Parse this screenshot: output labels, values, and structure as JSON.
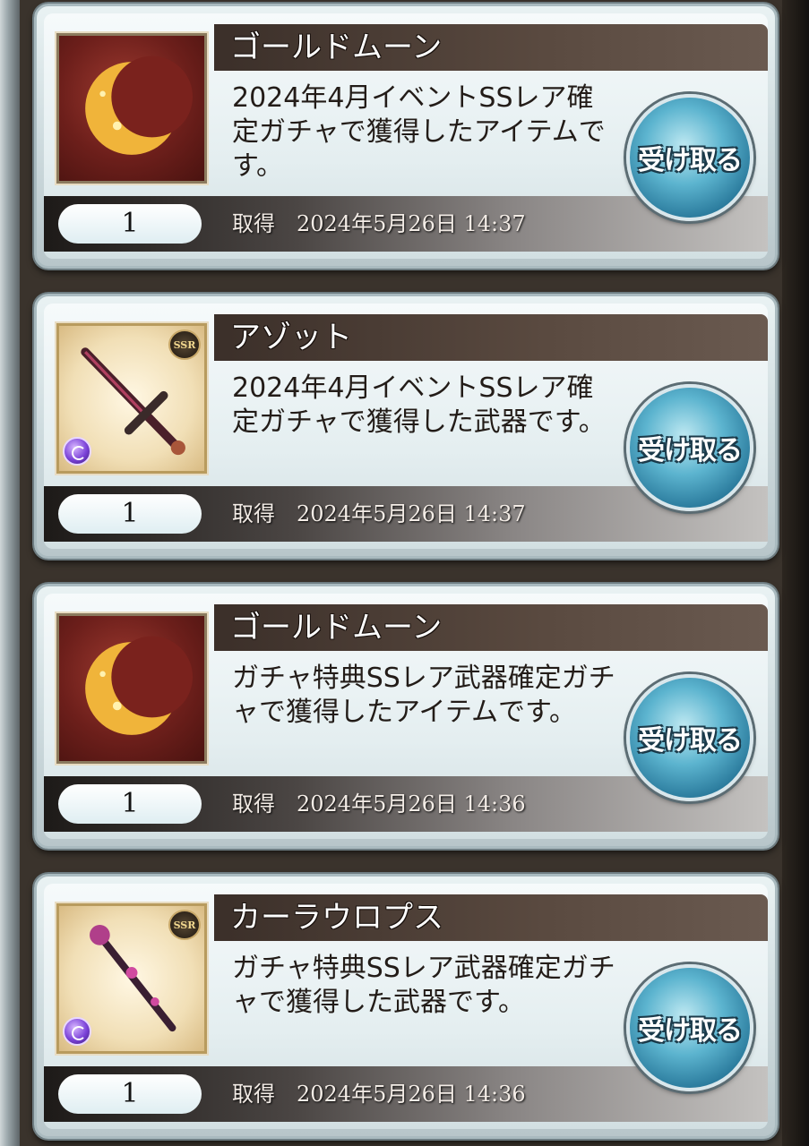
{
  "items": [
    {
      "name": "ゴールドムーン",
      "description": "2024年4月イベントSSレア確定ガチャで獲得したアイテムです。",
      "quantity": "1",
      "acquired_label": "取得",
      "acquired_date": "2024年5月26日 14:37",
      "receive_label": "受け取る",
      "icon": "gold-moon-icon",
      "rarity_badge": ""
    },
    {
      "name": "アゾット",
      "description": "2024年4月イベントSSレア確定ガチャで獲得した武器です。",
      "quantity": "1",
      "acquired_label": "取得",
      "acquired_date": "2024年5月26日 14:37",
      "receive_label": "受け取る",
      "icon": "sword-icon",
      "rarity_badge": "SSR"
    },
    {
      "name": "ゴールドムーン",
      "description": "ガチャ特典SSレア武器確定ガチャで獲得したアイテムです。",
      "quantity": "1",
      "acquired_label": "取得",
      "acquired_date": "2024年5月26日 14:36",
      "receive_label": "受け取る",
      "icon": "gold-moon-icon",
      "rarity_badge": ""
    },
    {
      "name": "カーラウロプス",
      "description": "ガチャ特典SSレア武器確定ガチャで獲得した武器です。",
      "quantity": "1",
      "acquired_label": "取得",
      "acquired_date": "2024年5月26日 14:36",
      "receive_label": "受け取る",
      "icon": "staff-icon",
      "rarity_badge": "SSR"
    }
  ],
  "colors": {
    "name_bar": "#3b2f29",
    "button": "#2a7a9c",
    "card": "#e4eef0"
  }
}
